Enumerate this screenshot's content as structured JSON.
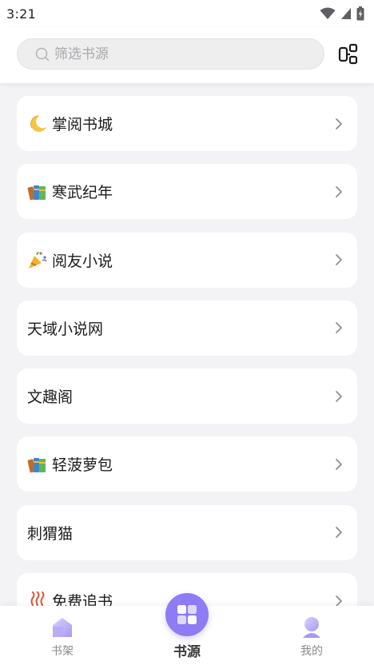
{
  "status_bar": {
    "time": "3:21"
  },
  "search": {
    "placeholder": "筛选书源"
  },
  "sources": [
    {
      "label": "掌阅书城",
      "icon": "crescent-moon-emoji"
    },
    {
      "label": "寒武纪年",
      "icon": "books-emoji"
    },
    {
      "label": "阅友小说",
      "icon": "party-popper-emoji"
    },
    {
      "label": "天域小说网",
      "icon": ""
    },
    {
      "label": "文趣阁",
      "icon": ""
    },
    {
      "label": "轻菠萝包",
      "icon": "books-emoji"
    },
    {
      "label": "刺猬猫",
      "icon": ""
    },
    {
      "label": "免费追书",
      "icon": "hot-springs-emoji"
    }
  ],
  "bottom_nav": {
    "bookshelf": "书架",
    "sources": "书源",
    "mine": "我的"
  },
  "colors": {
    "accent": "#8d7cf4",
    "background": "#f3f3f5",
    "card": "#ffffff"
  }
}
